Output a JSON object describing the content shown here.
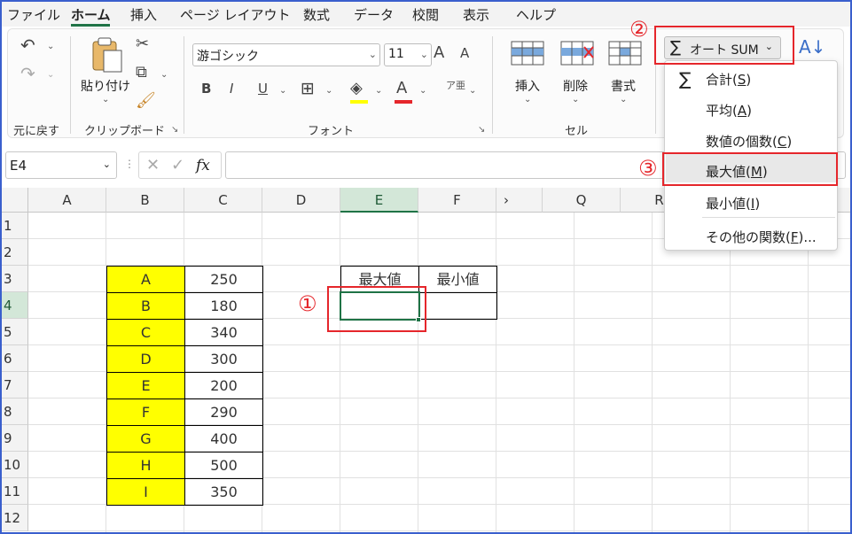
{
  "menu": {
    "tabs": [
      "ファイル",
      "ホーム",
      "挿入",
      "ページ レイアウト",
      "数式",
      "データ",
      "校閲",
      "表示",
      "ヘルプ"
    ],
    "active": "ホーム"
  },
  "ribbon": {
    "undo_group_label": "元に戻す",
    "paste_label": "貼り付け",
    "clipboard_label": "クリップボード",
    "font_name": "游ゴシック",
    "font_size": "11",
    "bold": "B",
    "italic": "I",
    "underline": "U",
    "font_color_glyph": "A",
    "grow_font": "A",
    "shrink_font": "A",
    "font_label": "フォント",
    "insert_label": "挿入",
    "delete_label": "削除",
    "format_label": "書式",
    "cells_label": "セル",
    "autosum_label": "オート SUM"
  },
  "formula_bar": {
    "name_box": "E4",
    "fx": "fx",
    "value": ""
  },
  "grid": {
    "columns": [
      "A",
      "B",
      "C",
      "D",
      "E",
      "F",
      "Q",
      "R"
    ],
    "rows": [
      "1",
      "2",
      "3",
      "4",
      "5",
      "6",
      "7",
      "8",
      "9",
      "10",
      "11",
      "12"
    ],
    "table1": [
      {
        "label": "A",
        "value": "250"
      },
      {
        "label": "B",
        "value": "180"
      },
      {
        "label": "C",
        "value": "340"
      },
      {
        "label": "D",
        "value": "300"
      },
      {
        "label": "E",
        "value": "200"
      },
      {
        "label": "F",
        "value": "290"
      },
      {
        "label": "G",
        "value": "400"
      },
      {
        "label": "H",
        "value": "500"
      },
      {
        "label": "I",
        "value": "350"
      }
    ],
    "max_header": "最大値",
    "min_header": "最小値",
    "selected_cell": "E4"
  },
  "dropdown": {
    "sum": "合計",
    "sum_key": "S",
    "average": "平均",
    "average_key": "A",
    "count": "数値の個数",
    "count_key": "C",
    "max": "最大値",
    "max_key": "M",
    "min": "最小値",
    "min_key": "I",
    "more": "その他の関数",
    "more_key": "F"
  },
  "annotations": {
    "step1": "①",
    "step2": "②",
    "step3": "③"
  },
  "colors": {
    "accent_green": "#1f7346",
    "highlight_red": "#e5262b",
    "cell_yellow": "#ffff00"
  }
}
